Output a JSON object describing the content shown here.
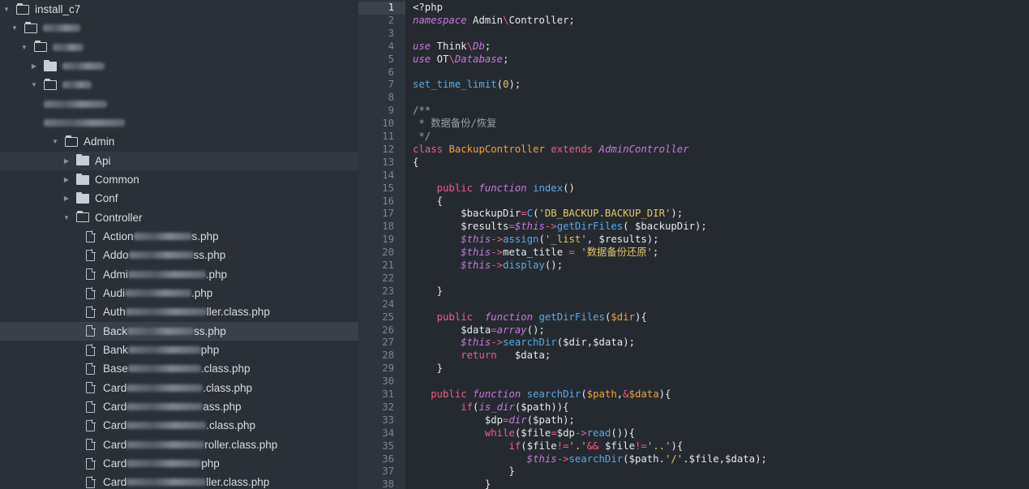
{
  "sidebar": {
    "rows": [
      {
        "indent": 0,
        "chevron": "open",
        "icon": "folder-open",
        "text": "install_c7",
        "blur": 0
      },
      {
        "indent": 1,
        "chevron": "open",
        "icon": "folder-open",
        "text": "",
        "blur": 46
      },
      {
        "indent": 2,
        "chevron": "open",
        "icon": "folder-open",
        "text": "",
        "blur": 38
      },
      {
        "indent": 3,
        "chevron": "closed",
        "icon": "folder",
        "text": "",
        "blur": 52
      },
      {
        "indent": 3,
        "chevron": "open",
        "icon": "folder-open",
        "text": "",
        "blur": 36
      },
      {
        "indent": 4,
        "chevron": "none",
        "icon": "none",
        "text": "",
        "blur": 78
      },
      {
        "indent": 4,
        "chevron": "none",
        "icon": "none",
        "text": "",
        "blur": 100
      },
      {
        "indent": 5,
        "chevron": "open",
        "icon": "folder-open",
        "text": "Admin",
        "blur": 0
      },
      {
        "indent": 6,
        "chevron": "closed",
        "icon": "folder",
        "text": "Api",
        "blur": 0,
        "hl": true
      },
      {
        "indent": 6,
        "chevron": "closed",
        "icon": "folder",
        "text": "Common",
        "blur": 0
      },
      {
        "indent": 6,
        "chevron": "closed",
        "icon": "folder",
        "text": "Conf",
        "blur": 0
      },
      {
        "indent": 6,
        "chevron": "open",
        "icon": "folder-open",
        "text": "Controller",
        "blur": 0
      },
      {
        "indent": 7,
        "chevron": "none",
        "icon": "file",
        "prefix": "Action",
        "blur": 72,
        "text": "s.php"
      },
      {
        "indent": 7,
        "chevron": "none",
        "icon": "file",
        "prefix": "Addo",
        "blur": 80,
        "text": "ss.php"
      },
      {
        "indent": 7,
        "chevron": "none",
        "icon": "file",
        "prefix": "Admi",
        "blur": 96,
        "text": ".php"
      },
      {
        "indent": 7,
        "chevron": "none",
        "icon": "file",
        "prefix": "Audi",
        "blur": 82,
        "text": ".php"
      },
      {
        "indent": 7,
        "chevron": "none",
        "icon": "file",
        "prefix": "Auth",
        "blur": 100,
        "text": "ller.class.php"
      },
      {
        "indent": 7,
        "chevron": "none",
        "icon": "file",
        "prefix": "Back",
        "blur": 82,
        "text": "ss.php",
        "selected": true
      },
      {
        "indent": 7,
        "chevron": "none",
        "icon": "file",
        "prefix": "Bank",
        "blur": 90,
        "text": "php"
      },
      {
        "indent": 7,
        "chevron": "none",
        "icon": "file",
        "prefix": "Base",
        "blur": 90,
        "text": ".class.php"
      },
      {
        "indent": 7,
        "chevron": "none",
        "icon": "file",
        "prefix": "Card",
        "blur": 94,
        "text": ".class.php"
      },
      {
        "indent": 7,
        "chevron": "none",
        "icon": "file",
        "prefix": "Card",
        "blur": 94,
        "text": "ass.php"
      },
      {
        "indent": 7,
        "chevron": "none",
        "icon": "file",
        "prefix": "Card",
        "blur": 98,
        "text": ".class.php"
      },
      {
        "indent": 7,
        "chevron": "none",
        "icon": "file",
        "prefix": "Card",
        "blur": 96,
        "text": "roller.class.php"
      },
      {
        "indent": 7,
        "chevron": "none",
        "icon": "file",
        "prefix": "Card",
        "blur": 92,
        "text": "php"
      },
      {
        "indent": 7,
        "chevron": "none",
        "icon": "file",
        "prefix": "Card",
        "blur": 98,
        "text": "ller.class.php"
      }
    ]
  },
  "editor": {
    "current_line": 1,
    "lines": [
      [
        [
          "p",
          "<?php"
        ]
      ],
      [
        [
          "it",
          "namespace"
        ],
        [
          "p",
          " Admin"
        ],
        [
          "kw",
          "\\"
        ],
        [
          "p",
          "Controller;"
        ]
      ],
      [],
      [
        [
          "it",
          "use"
        ],
        [
          "p",
          " Think"
        ],
        [
          "kw",
          "\\"
        ],
        [
          "it",
          "Db"
        ],
        [
          "p",
          ";"
        ]
      ],
      [
        [
          "it",
          "use"
        ],
        [
          "p",
          " OT"
        ],
        [
          "kw",
          "\\"
        ],
        [
          "it",
          "Database"
        ],
        [
          "p",
          ";"
        ]
      ],
      [],
      [
        [
          "fn",
          "set_time_limit"
        ],
        [
          "p",
          "("
        ],
        [
          "st",
          "0"
        ],
        [
          "p",
          ");"
        ]
      ],
      [],
      [
        [
          "cm",
          "/**"
        ]
      ],
      [
        [
          "cm",
          " * 数据备份/恢复"
        ]
      ],
      [
        [
          "cm",
          " */"
        ]
      ],
      [
        [
          "kw",
          "class"
        ],
        [
          "p",
          " "
        ],
        [
          "cl",
          "BackupController"
        ],
        [
          "p",
          " "
        ],
        [
          "kw",
          "extends"
        ],
        [
          "p",
          " "
        ],
        [
          "it",
          "AdminController"
        ]
      ],
      [
        [
          "p",
          "{"
        ]
      ],
      [],
      [
        [
          "p",
          "    "
        ],
        [
          "kw",
          "public"
        ],
        [
          "p",
          " "
        ],
        [
          "it",
          "function"
        ],
        [
          "p",
          " "
        ],
        [
          "fn",
          "index"
        ],
        [
          "p",
          "()"
        ]
      ],
      [
        [
          "p",
          "    {"
        ]
      ],
      [
        [
          "p",
          "        "
        ],
        [
          "var",
          "$backupDir"
        ],
        [
          "kw",
          "="
        ],
        [
          "fn",
          "C"
        ],
        [
          "p",
          "("
        ],
        [
          "st",
          "'DB_BACKUP.BACKUP_DIR'"
        ],
        [
          "p",
          ");"
        ]
      ],
      [
        [
          "p",
          "        "
        ],
        [
          "var",
          "$results"
        ],
        [
          "kw",
          "="
        ],
        [
          "it",
          "$this"
        ],
        [
          "kw",
          "->"
        ],
        [
          "fn",
          "getDirFiles"
        ],
        [
          "p",
          "( "
        ],
        [
          "var",
          "$backupDir"
        ],
        [
          "p",
          ");"
        ]
      ],
      [
        [
          "p",
          "        "
        ],
        [
          "it",
          "$this"
        ],
        [
          "kw",
          "->"
        ],
        [
          "fn",
          "assign"
        ],
        [
          "p",
          "("
        ],
        [
          "st",
          "'_list'"
        ],
        [
          "p",
          ", "
        ],
        [
          "var",
          "$results"
        ],
        [
          "p",
          ");"
        ]
      ],
      [
        [
          "p",
          "        "
        ],
        [
          "it",
          "$this"
        ],
        [
          "kw",
          "->"
        ],
        [
          "p",
          "meta_title "
        ],
        [
          "kw",
          "="
        ],
        [
          "p",
          " "
        ],
        [
          "st",
          "'数据备份还原'"
        ],
        [
          "p",
          ";"
        ]
      ],
      [
        [
          "p",
          "        "
        ],
        [
          "it",
          "$this"
        ],
        [
          "kw",
          "->"
        ],
        [
          "fn",
          "display"
        ],
        [
          "p",
          "();"
        ]
      ],
      [],
      [
        [
          "p",
          "    }"
        ]
      ],
      [],
      [
        [
          "p",
          "    "
        ],
        [
          "kw",
          "public"
        ],
        [
          "p",
          "  "
        ],
        [
          "it",
          "function"
        ],
        [
          "p",
          " "
        ],
        [
          "fn",
          "getDirFiles"
        ],
        [
          "p",
          "("
        ],
        [
          "dl",
          "$dir"
        ],
        [
          "p",
          "){"
        ]
      ],
      [
        [
          "p",
          "        "
        ],
        [
          "var",
          "$data"
        ],
        [
          "kw",
          "="
        ],
        [
          "it",
          "array"
        ],
        [
          "p",
          "();"
        ]
      ],
      [
        [
          "p",
          "        "
        ],
        [
          "it",
          "$this"
        ],
        [
          "kw",
          "->"
        ],
        [
          "fn",
          "searchDir"
        ],
        [
          "p",
          "("
        ],
        [
          "var",
          "$dir"
        ],
        [
          "p",
          ","
        ],
        [
          "var",
          "$data"
        ],
        [
          "p",
          ");"
        ]
      ],
      [
        [
          "p",
          "        "
        ],
        [
          "kw",
          "return"
        ],
        [
          "p",
          "   "
        ],
        [
          "var",
          "$data"
        ],
        [
          "p",
          ";"
        ]
      ],
      [
        [
          "p",
          "    }"
        ]
      ],
      [],
      [
        [
          "p",
          "   "
        ],
        [
          "kw",
          "public"
        ],
        [
          "p",
          " "
        ],
        [
          "it",
          "function"
        ],
        [
          "p",
          " "
        ],
        [
          "fn",
          "searchDir"
        ],
        [
          "p",
          "("
        ],
        [
          "dl",
          "$path"
        ],
        [
          "p",
          ","
        ],
        [
          "kw",
          "&"
        ],
        [
          "dl",
          "$data"
        ],
        [
          "p",
          "){"
        ]
      ],
      [
        [
          "p",
          "        "
        ],
        [
          "kw",
          "if"
        ],
        [
          "p",
          "("
        ],
        [
          "it",
          "is_dir"
        ],
        [
          "p",
          "("
        ],
        [
          "var",
          "$path"
        ],
        [
          "p",
          "))"
        ],
        [
          "p",
          "{"
        ]
      ],
      [
        [
          "p",
          "            "
        ],
        [
          "var",
          "$dp"
        ],
        [
          "kw",
          "="
        ],
        [
          "it",
          "dir"
        ],
        [
          "p",
          "("
        ],
        [
          "var",
          "$path"
        ],
        [
          "p",
          ");"
        ]
      ],
      [
        [
          "p",
          "            "
        ],
        [
          "kw",
          "while"
        ],
        [
          "p",
          "("
        ],
        [
          "var",
          "$file"
        ],
        [
          "kw",
          "="
        ],
        [
          "var",
          "$dp"
        ],
        [
          "kw",
          "->"
        ],
        [
          "fn",
          "read"
        ],
        [
          "p",
          "()){"
        ]
      ],
      [
        [
          "p",
          "                "
        ],
        [
          "kw",
          "if"
        ],
        [
          "p",
          "("
        ],
        [
          "var",
          "$file"
        ],
        [
          "kw",
          "!="
        ],
        [
          "st",
          "'.'"
        ],
        [
          "kw",
          "&&"
        ],
        [
          "p",
          " "
        ],
        [
          "var",
          "$file"
        ],
        [
          "kw",
          "!="
        ],
        [
          "st",
          "'..'"
        ],
        [
          "p",
          "){"
        ]
      ],
      [
        [
          "p",
          "                   "
        ],
        [
          "it",
          "$this"
        ],
        [
          "kw",
          "->"
        ],
        [
          "fn",
          "searchDir"
        ],
        [
          "p",
          "("
        ],
        [
          "var",
          "$path"
        ],
        [
          "p",
          "."
        ],
        [
          "st",
          "'/'"
        ],
        [
          "p",
          "."
        ],
        [
          "var",
          "$file"
        ],
        [
          "p",
          ","
        ],
        [
          "var",
          "$data"
        ],
        [
          "p",
          ");"
        ]
      ],
      [
        [
          "p",
          "                }"
        ]
      ],
      [
        [
          "p",
          "            }"
        ]
      ]
    ],
    "line_numbers": [
      "1",
      "2",
      "3",
      "4",
      "5",
      "6",
      "7",
      "8",
      "9",
      "10",
      "11",
      "12",
      "13",
      "14",
      "15",
      "16",
      "17",
      "18",
      "19",
      "20",
      "21",
      "22",
      "23",
      "24",
      "25",
      "26",
      "27",
      "28",
      "29",
      "30",
      "31",
      "32",
      "33",
      "34",
      "35",
      "36",
      "37",
      "38"
    ]
  }
}
